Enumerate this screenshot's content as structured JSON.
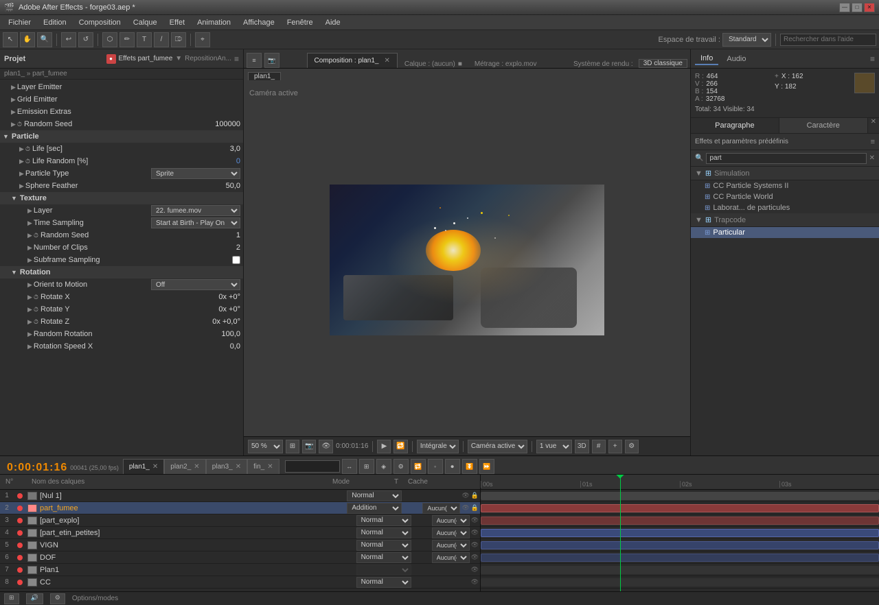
{
  "titleBar": {
    "title": "Adobe After Effects - forge03.aep *",
    "minimize": "—",
    "maximize": "□",
    "close": "✕"
  },
  "menuBar": {
    "items": [
      "Fichier",
      "Edition",
      "Composition",
      "Calque",
      "Effet",
      "Animation",
      "Affichage",
      "Fenêtre",
      "Aide"
    ]
  },
  "toolbar": {
    "workarea_label": "Espace de travail :",
    "workarea_value": "Standard",
    "search_placeholder": "Rechercher dans l'aide"
  },
  "leftPanel": {
    "title": "Projet",
    "effects_label": "Effets part_fumee",
    "breadcrumb": "plan1_ » part_fumee",
    "properties": [
      {
        "indent": 1,
        "name": "Layer Emitter",
        "value": "",
        "arrow": "▶"
      },
      {
        "indent": 1,
        "name": "Grid Emitter",
        "value": "",
        "arrow": "▶"
      },
      {
        "indent": 1,
        "name": "Emission Extras",
        "value": "",
        "arrow": "▶"
      },
      {
        "indent": 1,
        "name": "Random Seed",
        "value": "100000",
        "arrow": "▶",
        "icon": "⏱"
      },
      {
        "indent": 0,
        "name": "Particle",
        "value": "",
        "arrow": "▼",
        "section": true
      },
      {
        "indent": 2,
        "name": "Life [sec]",
        "value": "3,0",
        "arrow": "▶",
        "icon": "⏱"
      },
      {
        "indent": 2,
        "name": "Life Random [%]",
        "value": "0",
        "arrow": "▶",
        "icon": "⏱"
      },
      {
        "indent": 2,
        "name": "Particle Type",
        "value": "Sprite",
        "arrow": "▶",
        "dropdown": true
      },
      {
        "indent": 2,
        "name": "Sphere Feather",
        "value": "50,0",
        "arrow": "▶"
      },
      {
        "indent": 1,
        "name": "Texture",
        "value": "",
        "arrow": "▼",
        "section": true
      },
      {
        "indent": 3,
        "name": "Layer",
        "value": "22. fumee.mov",
        "arrow": "▶",
        "dropdown": true
      },
      {
        "indent": 3,
        "name": "Time Sampling",
        "value": "Start at Birth - Play On",
        "arrow": "▶",
        "dropdown": true
      },
      {
        "indent": 3,
        "name": "Random Seed",
        "value": "1",
        "arrow": "▶",
        "icon": "⏱"
      },
      {
        "indent": 3,
        "name": "Number of Clips",
        "value": "2",
        "arrow": "▶"
      },
      {
        "indent": 3,
        "name": "Subframe Sampling",
        "value": "",
        "arrow": "▶",
        "checkbox": true
      },
      {
        "indent": 1,
        "name": "Rotation",
        "value": "",
        "arrow": "▼",
        "section": true
      },
      {
        "indent": 3,
        "name": "Orient to Motion",
        "value": "Off",
        "arrow": "▶",
        "dropdown": true
      },
      {
        "indent": 3,
        "name": "Rotate X",
        "value": "0x +0°",
        "arrow": "▶",
        "icon": "⏱"
      },
      {
        "indent": 3,
        "name": "Rotate Y",
        "value": "0x +0°",
        "arrow": "▶",
        "icon": "⏱"
      },
      {
        "indent": 3,
        "name": "Rotate Z",
        "value": "0x +0,0°",
        "arrow": "▶",
        "icon": "⏱"
      },
      {
        "indent": 3,
        "name": "Random Rotation",
        "value": "100,0",
        "arrow": "▶"
      },
      {
        "indent": 3,
        "name": "Rotation Speed X",
        "value": "0,0",
        "arrow": "▶"
      }
    ]
  },
  "viewer": {
    "compositionLabel": "Composition : plan1_",
    "layerLabel": "Calque : (aucun)",
    "footageLabel": "Métrage : explo.mov",
    "cameraLabel": "Caméra active",
    "zoomLevel": "50 %",
    "renderMode": "3D classique",
    "timeCode": "0:00:01:16",
    "viewMode": "Intégrale",
    "camera": "Caméra active",
    "views": "1 vue"
  },
  "rightPanel": {
    "tabs": [
      "Info",
      "Audio"
    ],
    "colorR": "R : 464",
    "colorG": "V : 266",
    "colorB": "B : 154",
    "colorA": "A : 32768",
    "posX": "X : 162",
    "posY": "Y : 182",
    "total": "Total: 34  Visible: 34",
    "paraTabs": [
      "Paragraphe",
      "Caractère"
    ],
    "effectsTitle": "Effets et paramètres prédéfinis",
    "searchPlaceholder": "part",
    "categories": [
      {
        "name": "Simulation",
        "items": [
          "CC Particle Systems II",
          "CC Particle World",
          "Laborat... de particules"
        ]
      },
      {
        "name": "Trapcode",
        "items": [
          "Particular"
        ]
      }
    ]
  },
  "timeline": {
    "timecode": "0:00:01:16",
    "fps": "00041 (25,00 fps)",
    "tabs": [
      "plan1_",
      "plan2_",
      "plan3_",
      "fin_"
    ],
    "activeTab": "plan1_",
    "columns": [
      "N°",
      "",
      "Nom des calques",
      "Mode",
      "T",
      "Cache"
    ],
    "layers": [
      {
        "num": 1,
        "name": "[Nul 1]",
        "mode": "Normal",
        "cache": "",
        "color": "#777",
        "visible": true
      },
      {
        "num": 2,
        "name": "part_fumee",
        "mode": "Addition",
        "cache": "Aucun(e)",
        "color": "#f88",
        "visible": true,
        "selected": true
      },
      {
        "num": 3,
        "name": "[part_explo]",
        "mode": "Normal",
        "cache": "Aucun(e)",
        "color": "#888",
        "visible": true
      },
      {
        "num": 4,
        "name": "[part_etin_petites]",
        "mode": "Normal",
        "cache": "Aucun(e)",
        "color": "#888",
        "visible": true
      },
      {
        "num": 5,
        "name": "VIGN",
        "mode": "Normal",
        "cache": "Aucun(e)",
        "color": "#888",
        "visible": true
      },
      {
        "num": 6,
        "name": "DOF",
        "mode": "Normal",
        "cache": "Aucun(e)",
        "color": "#888",
        "visible": true
      },
      {
        "num": 7,
        "name": "Plan1",
        "mode": "",
        "cache": "",
        "color": "#888",
        "visible": true
      },
      {
        "num": 8,
        "name": "CC",
        "mode": "Normal",
        "cache": "",
        "color": "#888",
        "visible": true
      }
    ],
    "rulerMarks": [
      "00s",
      "01s",
      "02s",
      "03s"
    ],
    "playheadPosition": 290,
    "optionsLabel": "Options/modes"
  },
  "bottomBar": {
    "btn1": "⊞",
    "btn2": "🔊",
    "btn3": "⚙"
  }
}
